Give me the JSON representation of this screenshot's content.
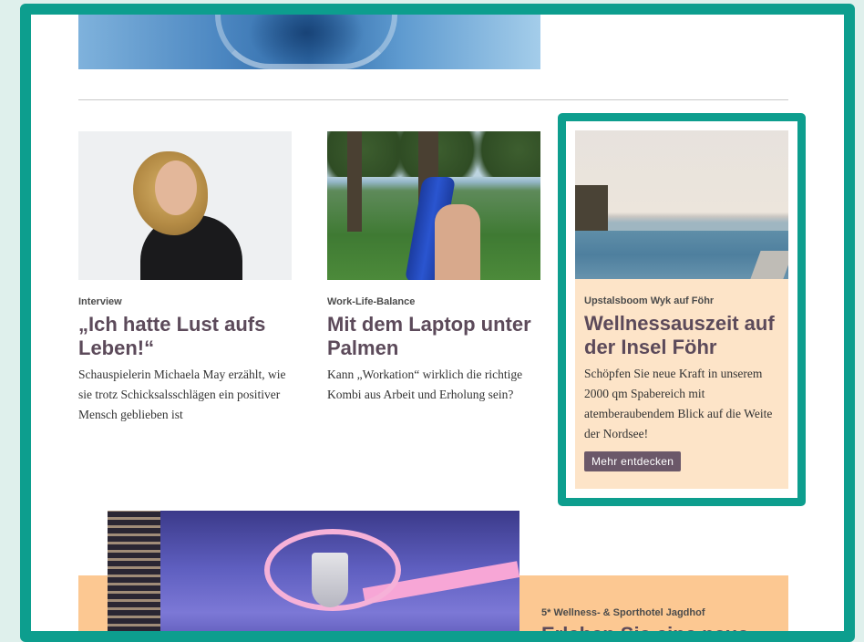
{
  "articles": [
    {
      "kicker": "Interview",
      "headline": "„Ich hatte Lust aufs Leben!“",
      "teaser": "Schauspielerin Michaela May erzählt, wie sie trotz Schicksalsschlägen ein positiver Mensch geblieben ist"
    },
    {
      "kicker": "Work-Life-Balance",
      "headline": "Mit dem Laptop unter Palmen",
      "teaser": "Kann „Workation“ wirklich die richtige Kombi aus Arbeit und Erholung sein?"
    }
  ],
  "featured": {
    "kicker": "Upstalsboom Wyk auf Föhr",
    "headline": "Wellnessauszeit auf der Insel Föhr",
    "teaser": "Schöpfen Sie neue Kraft in unserem 2000 qm Spabereich mit atemberaubendem Blick auf die Weite der Nordsee!",
    "cta_label": "Mehr entdecken"
  },
  "bottom_ad": {
    "kicker": "5* Wellness- & Sporthotel Jagdhof",
    "headline": "Erleben Sie eine neue"
  },
  "colors": {
    "frame": "#0d9e8e",
    "featured_panel": "#fde4c8",
    "ad_band": "#fcc892",
    "headline": "#5c4a5a",
    "cta": "#6b5869"
  }
}
